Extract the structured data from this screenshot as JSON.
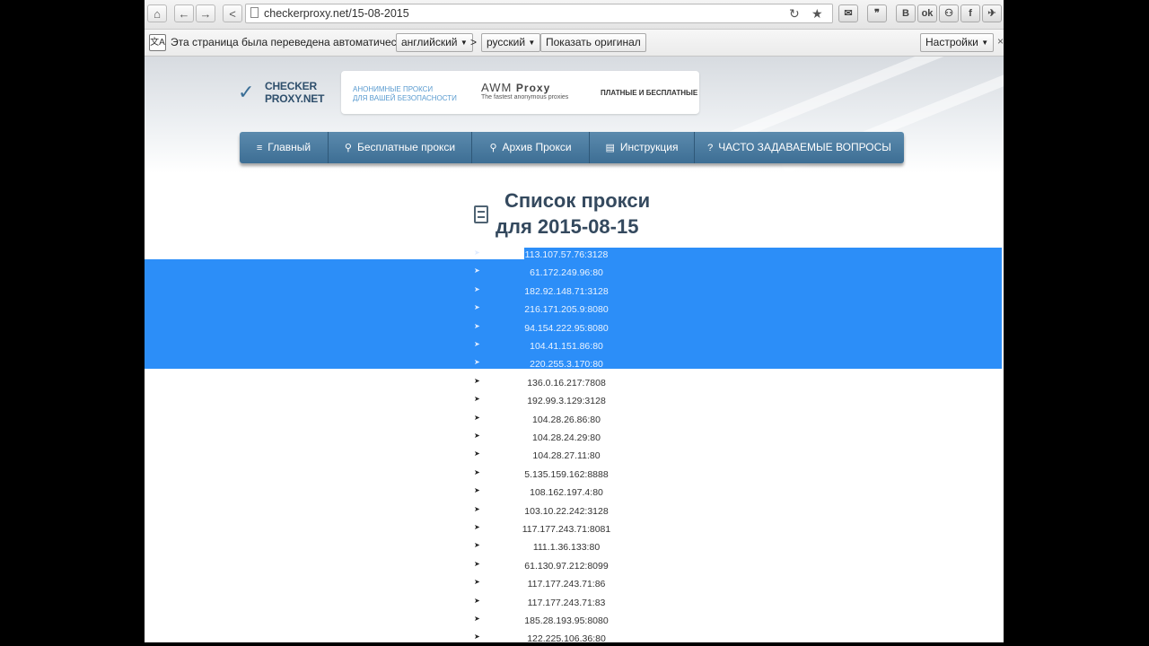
{
  "browser": {
    "url_host": "checkerproxy.net/",
    "url_path": "15-08-2015"
  },
  "translate_bar": {
    "message": "Эта страница была переведена автоматически",
    "from_lang": "английский",
    "to_lang": "русский",
    "show_original": "Показать оригинал",
    "settings": "Настройки"
  },
  "extensions": [
    "В",
    "ok",
    "f"
  ],
  "site": {
    "logo_line1": "CHECKER",
    "logo_line2": "PROXY.NET",
    "banner_left_1": "АНОНИМНЫЕ ПРОКСИ",
    "banner_left_2": "ДЛЯ ВАШЕЙ БЕЗОПАСНОСТИ",
    "banner_awm": "AWM",
    "banner_proxy": "Proxy",
    "banner_sub": "The fastest anonymous proxies",
    "banner_right": "ПЛАТНЫЕ И БЕСПЛАТНЫЕ"
  },
  "nav": [
    {
      "label": "Главный",
      "icon": "≡"
    },
    {
      "label": "Бесплатные прокси",
      "icon": "⚲"
    },
    {
      "label": "Архив Прокси",
      "icon": "⚲"
    },
    {
      "label": "Инструкция",
      "icon": "▤"
    },
    {
      "label": "ЧАСТО ЗАДАВАЕМЫЕ ВОПРОСЫ",
      "icon": "?"
    }
  ],
  "list": {
    "title_line1": "Список прокси",
    "title_line2": "для 2015-08-15",
    "selected_count": 7,
    "proxies": [
      "113.107.57.76:3128",
      "61.172.249.96:80",
      "182.92.148.71:3128",
      "216.171.205.9:8080",
      "94.154.222.95:8080",
      "104.41.151.86:80",
      "220.255.3.170:80",
      "136.0.16.217:7808",
      "192.99.3.129:3128",
      "104.28.26.86:80",
      "104.28.24.29:80",
      "104.28.27.11:80",
      "5.135.159.162:8888",
      "108.162.197.4:80",
      "103.10.22.242:3128",
      "117.177.243.71:8081",
      "111.1.36.133:80",
      "61.130.97.212:8099",
      "117.177.243.71:86",
      "117.177.243.71:83",
      "185.28.193.95:8080",
      "122.225.106.36:80"
    ]
  },
  "colors": {
    "selection": "#2c8ef8",
    "nav": "#4a7ba1",
    "title": "#34495e"
  }
}
